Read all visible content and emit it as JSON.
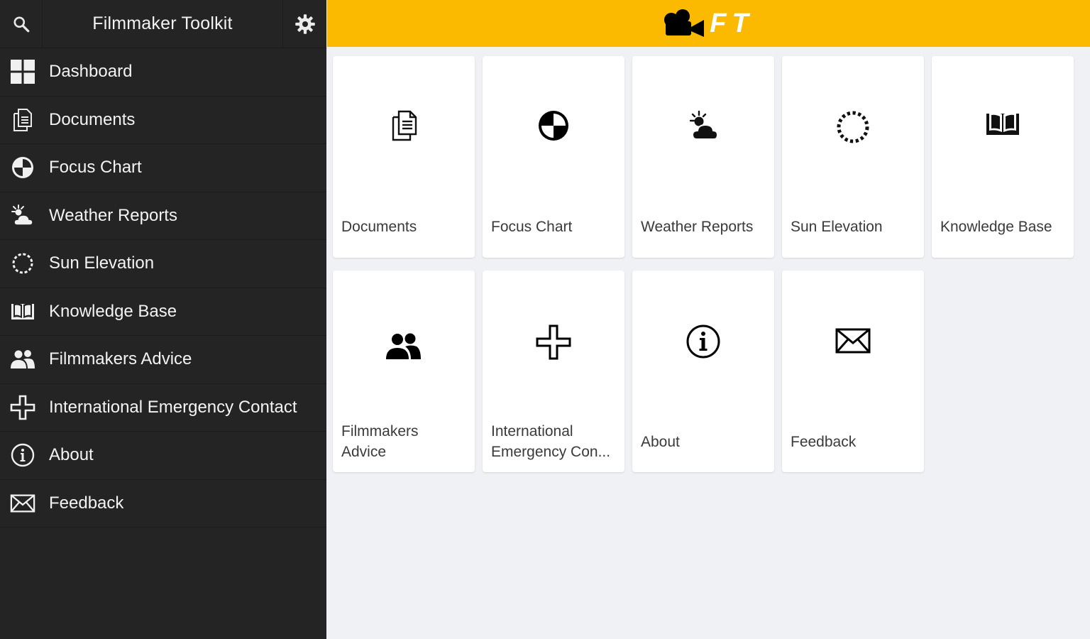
{
  "sidebar": {
    "title": "Filmmaker Toolkit",
    "search_icon": "search-icon",
    "settings_icon": "gear-icon",
    "items": [
      {
        "label": "Dashboard",
        "icon": "grid-icon"
      },
      {
        "label": "Documents",
        "icon": "documents-icon"
      },
      {
        "label": "Focus Chart",
        "icon": "focus-chart-icon"
      },
      {
        "label": "Weather Reports",
        "icon": "weather-icon"
      },
      {
        "label": "Sun Elevation",
        "icon": "sun-icon"
      },
      {
        "label": "Knowledge Base",
        "icon": "book-icon"
      },
      {
        "label": "Filmmakers Advice",
        "icon": "people-icon"
      },
      {
        "label": "International Emergency Contact",
        "icon": "cross-icon"
      },
      {
        "label": "About",
        "icon": "info-icon"
      },
      {
        "label": "Feedback",
        "icon": "envelope-icon"
      }
    ]
  },
  "topbar": {
    "logo_text": "FT",
    "logo_icon": "movie-camera-icon",
    "color": "#fbba00"
  },
  "tiles": [
    {
      "label": "Documents",
      "icon": "documents-icon"
    },
    {
      "label": "Focus Chart",
      "icon": "focus-chart-icon"
    },
    {
      "label": "Weather Reports",
      "icon": "weather-icon"
    },
    {
      "label": "Sun Elevation",
      "icon": "sun-icon"
    },
    {
      "label": "Knowledge Base",
      "icon": "book-icon"
    },
    {
      "label_line1": "Filmmakers",
      "label_line2": "Advice",
      "icon": "people-icon"
    },
    {
      "label_line1": "International",
      "label_line2": "Emergency Con...",
      "icon": "cross-icon"
    },
    {
      "label": "About",
      "icon": "info-icon"
    },
    {
      "label": "Feedback",
      "icon": "envelope-icon"
    }
  ],
  "colors": {
    "sidebar_bg": "#242424",
    "accent": "#fbba00",
    "content_bg": "#f0f1f5",
    "card_bg": "#ffffff"
  }
}
